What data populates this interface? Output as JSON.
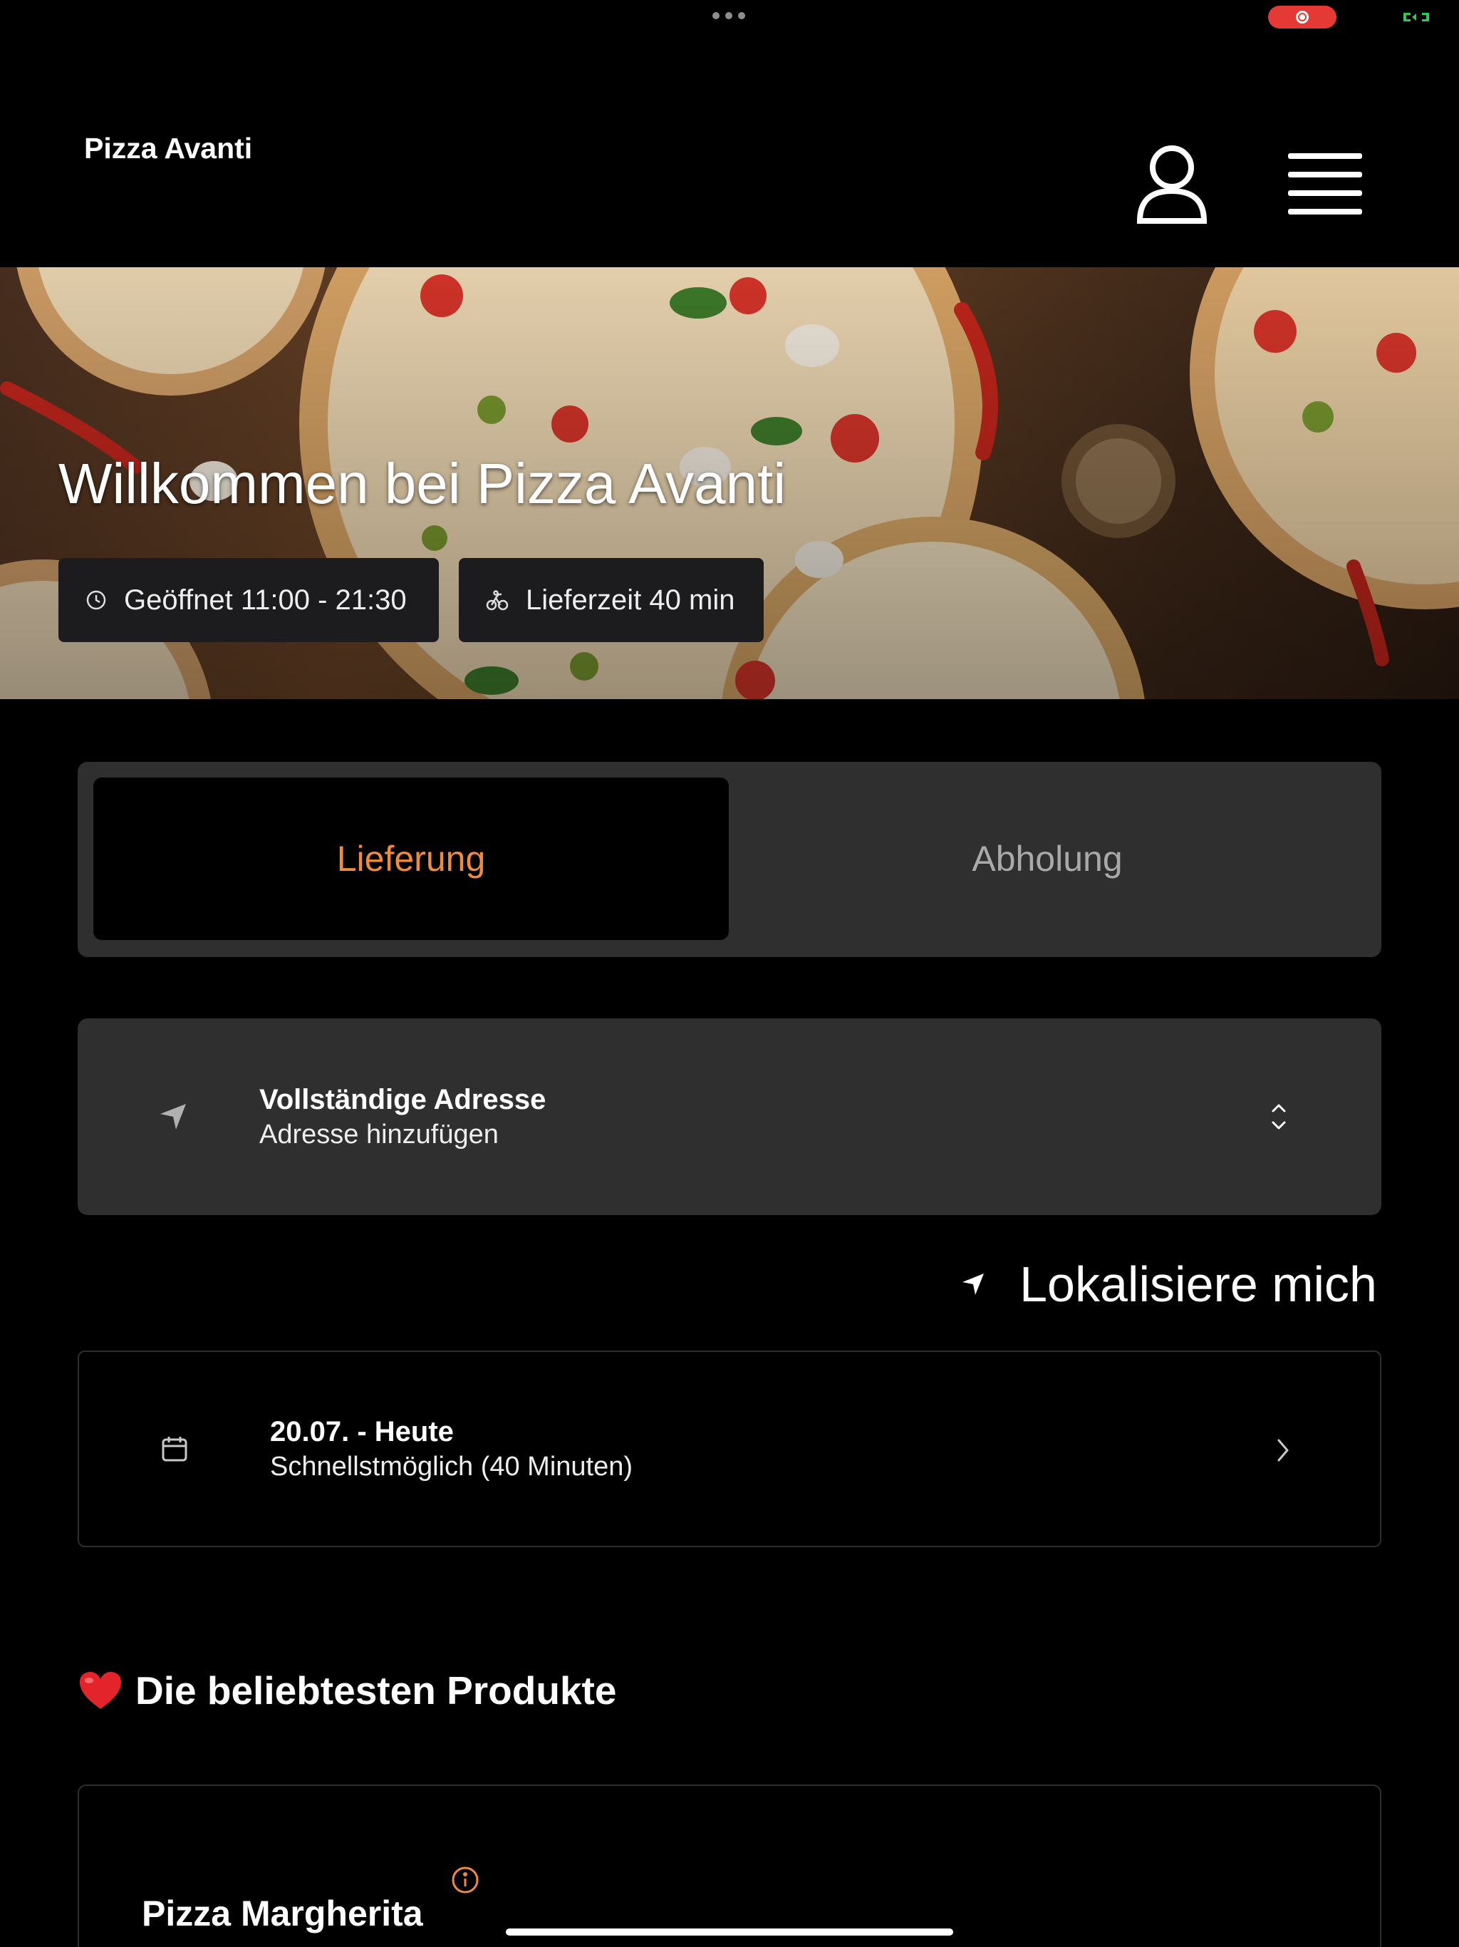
{
  "status_bar": {
    "icons": [
      "more-dots-icon",
      "screen-record-icon",
      "battery-icon"
    ],
    "record_color": "#e53935",
    "battery_color": "#34c759"
  },
  "header": {
    "brand": "Pizza Avanti",
    "icons": [
      "user-icon",
      "hamburger-menu-icon"
    ]
  },
  "hero": {
    "title": "Willkommen bei Pizza Avanti",
    "opening_hours": "Geöffnet 11:00 - 21:30",
    "delivery_time": "Lieferzeit 40 min",
    "icons": [
      "clock-icon",
      "bicycle-icon"
    ]
  },
  "order_mode": {
    "options": [
      {
        "label": "Lieferung",
        "active": true
      },
      {
        "label": "Abholung",
        "active": false
      }
    ],
    "accent": "#f08a3c"
  },
  "address": {
    "title": "Vollständige Adresse",
    "placeholder": "Adresse hinzufügen",
    "icons": [
      "location-arrow-icon",
      "chevron-up-down-icon"
    ]
  },
  "locate": {
    "label": "Lokalisiere mich"
  },
  "schedule": {
    "date": "20.07. - Heute",
    "time": "Schnellstmöglich (40 Minuten)",
    "icons": [
      "calendar-icon",
      "chevron-right-icon"
    ]
  },
  "popular": {
    "title": "Die beliebtesten Produkte",
    "products": [
      {
        "name": "Pizza Margherita"
      }
    ]
  }
}
